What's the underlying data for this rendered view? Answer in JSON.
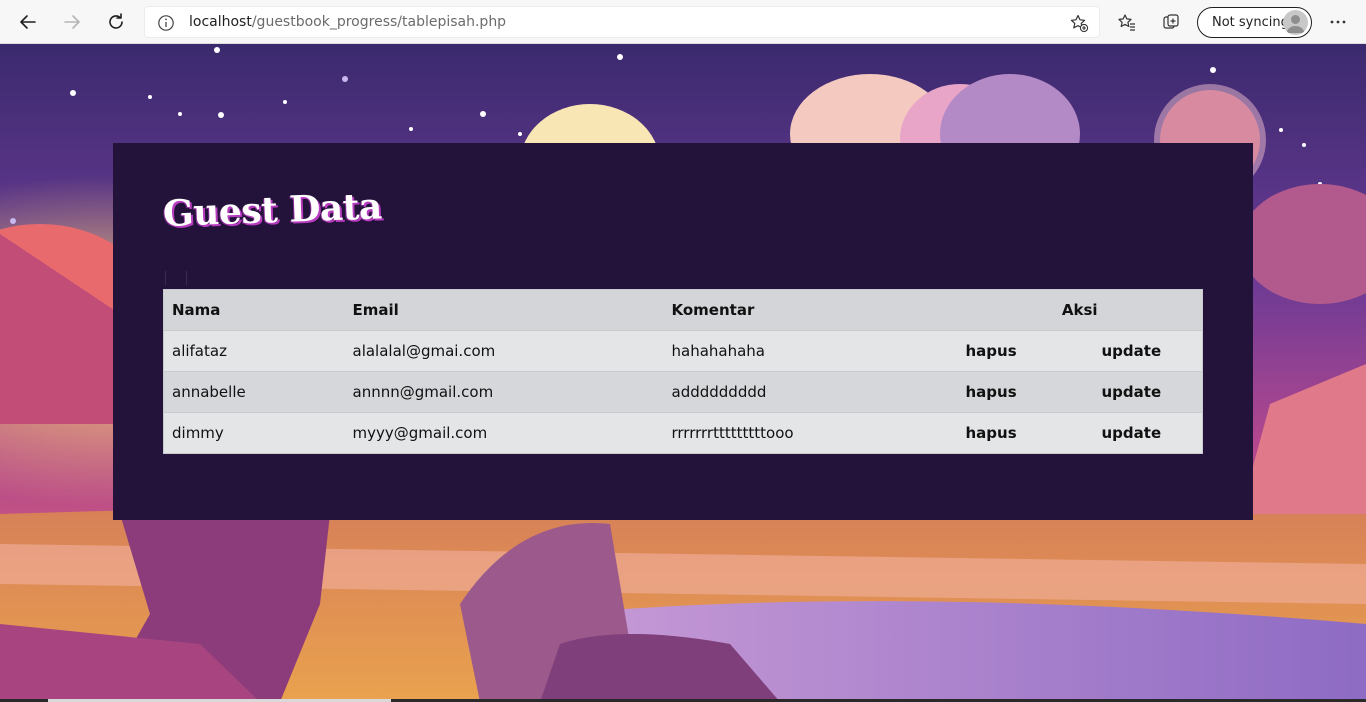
{
  "browser": {
    "url_host": "localhost",
    "url_path": "/guestbook_progress/tablepisah.php",
    "sync_label": "Not syncing"
  },
  "page": {
    "title": "Guest Data",
    "table": {
      "headers": {
        "nama": "Nama",
        "email": "Email",
        "komentar": "Komentar",
        "aksi": "Aksi"
      },
      "rows": [
        {
          "nama": "alifataz",
          "email": "alalalal@gmai.com",
          "komentar": "hahahahaha",
          "hapus": "hapus",
          "update": "update"
        },
        {
          "nama": "annabelle",
          "email": "annnn@gmail.com",
          "komentar": "addddddddd",
          "hapus": "hapus",
          "update": "update"
        },
        {
          "nama": "dimmy",
          "email": "myyy@gmail.com",
          "komentar": "rrrrrrrtttttttttooo",
          "hapus": "hapus",
          "update": "update"
        }
      ]
    }
  },
  "colors": {
    "card_bg": "#23123a",
    "header_row": "#d3d5d8",
    "row_light": "#e4e5e7",
    "row_dark": "#d5d7da",
    "title_shadow": "#b83cbf"
  }
}
